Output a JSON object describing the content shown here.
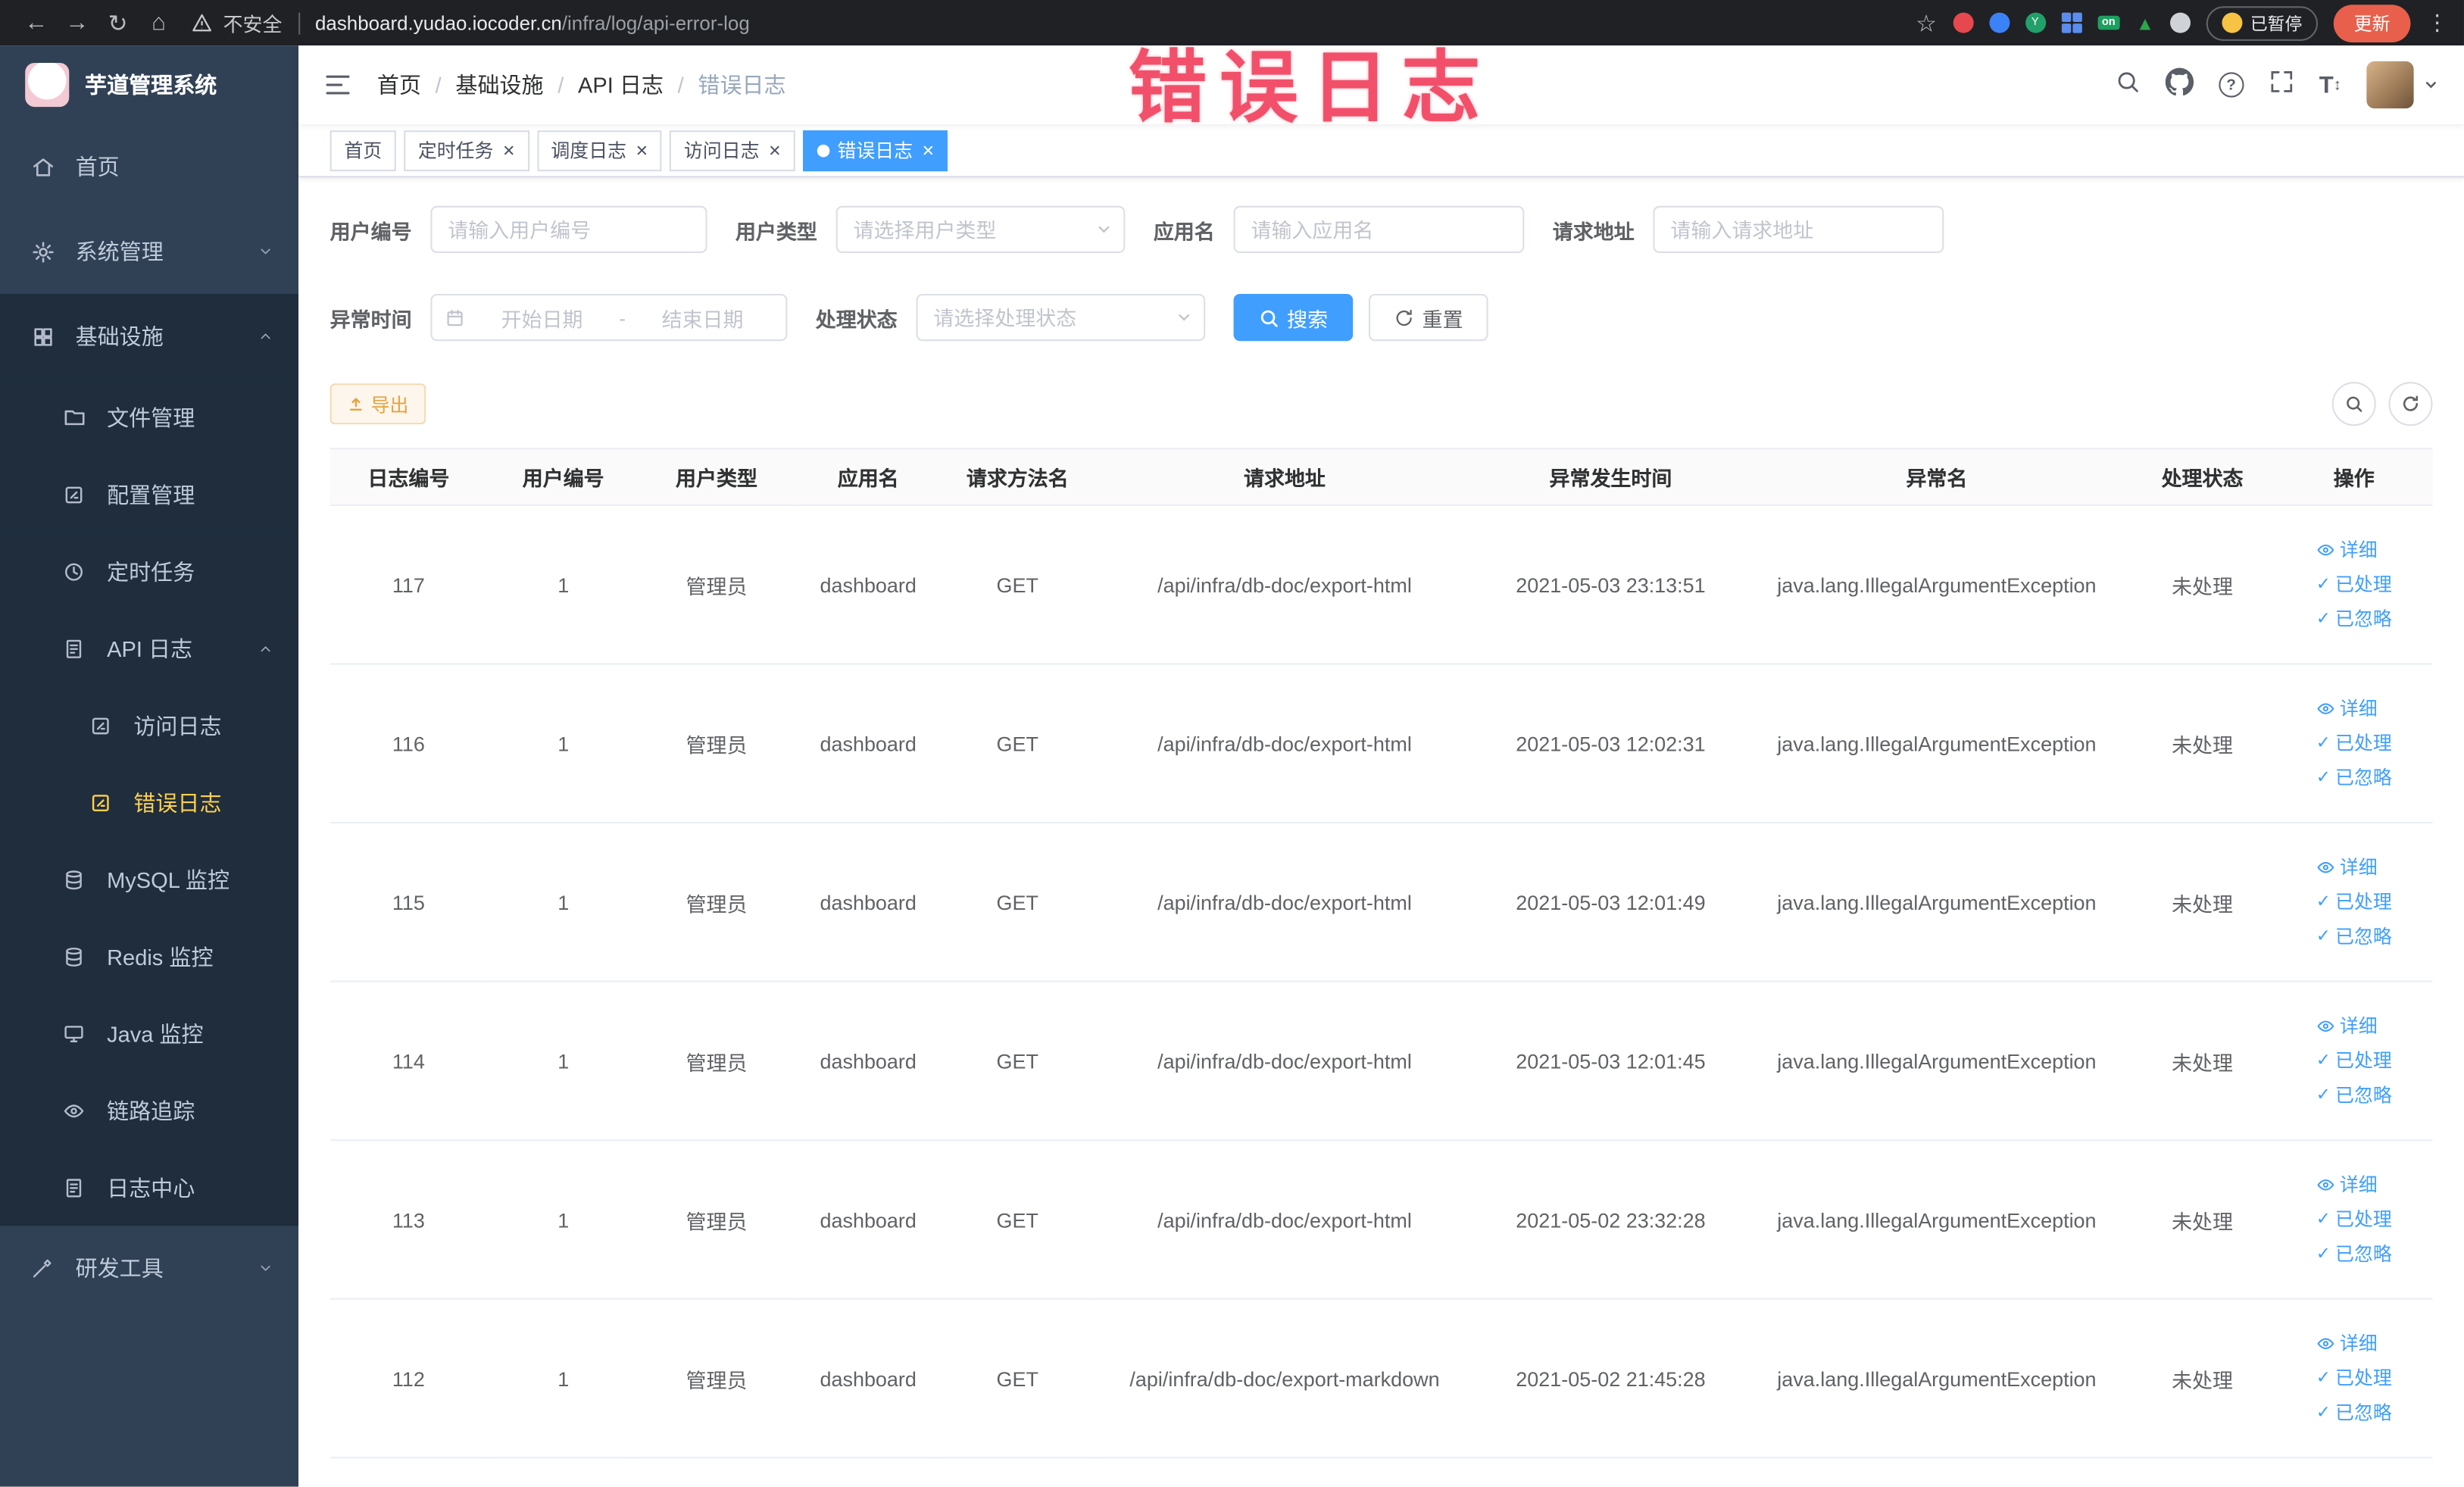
{
  "browser": {
    "security_label": "不安全",
    "url_domain": "dashboard.yudao.iocoder.cn",
    "url_path": "/infra/log/api-error-log",
    "paused_label": "已暂停",
    "update_label": "更新"
  },
  "annotation": {
    "text": "错误日志"
  },
  "sidebar": {
    "logo_title": "芋道管理系统",
    "items": [
      {
        "id": "home",
        "label": "首页",
        "icon": "home-icon",
        "level": 1
      },
      {
        "id": "system-mgmt",
        "label": "系统管理",
        "icon": "gear-icon",
        "level": 1,
        "chevron": "down"
      },
      {
        "id": "infrastructure",
        "label": "基础设施",
        "icon": "grid-icon",
        "level": 1,
        "chevron": "up",
        "section": true
      },
      {
        "id": "file-mgmt",
        "label": "文件管理",
        "icon": "folder-icon",
        "level": 2
      },
      {
        "id": "config-mgmt",
        "label": "配置管理",
        "icon": "edit-icon",
        "level": 2
      },
      {
        "id": "scheduled-task",
        "label": "定时任务",
        "icon": "clock-icon",
        "level": 2
      },
      {
        "id": "api-log",
        "label": "API 日志",
        "icon": "doc-icon",
        "level": 2,
        "chevron": "up"
      },
      {
        "id": "access-log",
        "label": "访问日志",
        "icon": "edit-icon",
        "level": 3
      },
      {
        "id": "error-log",
        "label": "错误日志",
        "icon": "edit-icon",
        "level": 3,
        "active": true
      },
      {
        "id": "mysql-monitor",
        "label": "MySQL 监控",
        "icon": "database-icon",
        "level": 2
      },
      {
        "id": "redis-monitor",
        "label": "Redis 监控",
        "icon": "database-icon",
        "level": 2
      },
      {
        "id": "java-monitor",
        "label": "Java 监控",
        "icon": "monitor-icon",
        "level": 2
      },
      {
        "id": "trace",
        "label": "链路追踪",
        "icon": "eye-icon",
        "level": 2
      },
      {
        "id": "log-center",
        "label": "日志中心",
        "icon": "doc-icon",
        "level": 2
      },
      {
        "id": "dev-tools",
        "label": "研发工具",
        "icon": "tools-icon",
        "level": 1,
        "chevron": "down"
      }
    ]
  },
  "navbar": {
    "breadcrumbs": [
      "首页",
      "基础设施",
      "API 日志",
      "错误日志"
    ]
  },
  "tabs": [
    {
      "label": "首页",
      "closable": false,
      "active": false
    },
    {
      "label": "定时任务",
      "closable": true,
      "active": false
    },
    {
      "label": "调度日志",
      "closable": true,
      "active": false
    },
    {
      "label": "访问日志",
      "closable": true,
      "active": false
    },
    {
      "label": "错误日志",
      "closable": true,
      "active": true
    }
  ],
  "filters": {
    "user_id": {
      "label": "用户编号",
      "placeholder": "请输入用户编号"
    },
    "user_type": {
      "label": "用户类型",
      "placeholder": "请选择用户类型"
    },
    "app_name": {
      "label": "应用名",
      "placeholder": "请输入应用名"
    },
    "request_url": {
      "label": "请求地址",
      "placeholder": "请输入请求地址"
    },
    "exception_time": {
      "label": "异常时间",
      "start_placeholder": "开始日期",
      "separator": "-",
      "end_placeholder": "结束日期"
    },
    "process_status": {
      "label": "处理状态",
      "placeholder": "请选择处理状态"
    },
    "search_label": "搜索",
    "reset_label": "重置"
  },
  "toolbar": {
    "export_label": "导出"
  },
  "table": {
    "columns": [
      {
        "key": "id",
        "label": "日志编号"
      },
      {
        "key": "user_id",
        "label": "用户编号"
      },
      {
        "key": "user_type",
        "label": "用户类型"
      },
      {
        "key": "app_name",
        "label": "应用名"
      },
      {
        "key": "method",
        "label": "请求方法名"
      },
      {
        "key": "url",
        "label": "请求地址"
      },
      {
        "key": "time",
        "label": "异常发生时间"
      },
      {
        "key": "exception",
        "label": "异常名"
      },
      {
        "key": "status",
        "label": "处理状态"
      },
      {
        "key": "actions",
        "label": "操作"
      }
    ],
    "rows": [
      {
        "id": "117",
        "user_id": "1",
        "user_type": "管理员",
        "app_name": "dashboard",
        "method": "GET",
        "url": "/api/infra/db-doc/export-html",
        "time": "2021-05-03 23:13:51",
        "exception": "java.lang.IllegalArgumentException",
        "status": "未处理"
      },
      {
        "id": "116",
        "user_id": "1",
        "user_type": "管理员",
        "app_name": "dashboard",
        "method": "GET",
        "url": "/api/infra/db-doc/export-html",
        "time": "2021-05-03 12:02:31",
        "exception": "java.lang.IllegalArgumentException",
        "status": "未处理"
      },
      {
        "id": "115",
        "user_id": "1",
        "user_type": "管理员",
        "app_name": "dashboard",
        "method": "GET",
        "url": "/api/infra/db-doc/export-html",
        "time": "2021-05-03 12:01:49",
        "exception": "java.lang.IllegalArgumentException",
        "status": "未处理"
      },
      {
        "id": "114",
        "user_id": "1",
        "user_type": "管理员",
        "app_name": "dashboard",
        "method": "GET",
        "url": "/api/infra/db-doc/export-html",
        "time": "2021-05-03 12:01:45",
        "exception": "java.lang.IllegalArgumentException",
        "status": "未处理"
      },
      {
        "id": "113",
        "user_id": "1",
        "user_type": "管理员",
        "app_name": "dashboard",
        "method": "GET",
        "url": "/api/infra/db-doc/export-html",
        "time": "2021-05-02 23:32:28",
        "exception": "java.lang.IllegalArgumentException",
        "status": "未处理"
      },
      {
        "id": "112",
        "user_id": "1",
        "user_type": "管理员",
        "app_name": "dashboard",
        "method": "GET",
        "url": "/api/infra/db-doc/export-markdown",
        "time": "2021-05-02 21:45:28",
        "exception": "java.lang.IllegalArgumentException",
        "status": "未处理"
      }
    ],
    "action_labels": [
      {
        "name": "detail-link",
        "label": "详细",
        "icon": "view-icon"
      },
      {
        "name": "processed-link",
        "label": "已处理",
        "icon": "check-icon"
      },
      {
        "name": "ignored-link",
        "label": "已忽略",
        "icon": "check-icon"
      }
    ]
  },
  "colors": {
    "primary": "#409eff",
    "sidebar_bg": "#304156",
    "submenu_bg": "#1f2d3d",
    "active_menu_text": "#ffd04b",
    "warning": "#e6a23c",
    "annotation": "#f2506a"
  }
}
